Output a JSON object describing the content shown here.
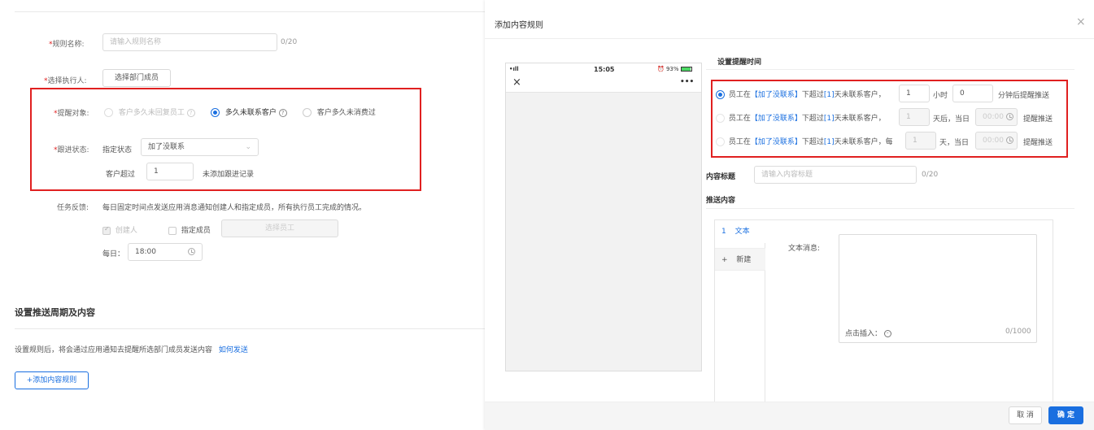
{
  "left": {
    "rule_name": {
      "label": "规则名称:",
      "placeholder": "请输入规则名称",
      "counter": "0/20"
    },
    "executor": {
      "label": "选择执行人:",
      "button": "选择部门成员"
    },
    "remind_target": {
      "label": "提醒对象:",
      "options": [
        {
          "label": "客户多久未回复员工",
          "state": "disabled"
        },
        {
          "label": "多久未联系客户",
          "state": "selected"
        },
        {
          "label": "客户多久未消费过",
          "state": "normal"
        }
      ]
    },
    "follow_status": {
      "label": "跟进状态:",
      "specify_label": "指定状态",
      "select_value": "加了没联系",
      "exceed_label": "客户超过",
      "exceed_value": "1",
      "suffix": "未添加跟进记录"
    },
    "task_feedback": {
      "label": "任务反馈:",
      "text": "每日固定时间点发送应用消息通知创建人和指定成员，所有执行员工完成的情况。",
      "creator_label": "创建人",
      "member_label": "指定成员",
      "select_member_button": "选择员工",
      "daily_label": "每日：",
      "daily_time": "18:00"
    },
    "push_section": {
      "title": "设置推送周期及内容",
      "desc": "设置规则后，将会通过应用通知去提醒所选部门成员发送内容",
      "link": "如何发送",
      "add_button": "+添加内容规则"
    }
  },
  "modal": {
    "title": "添加内容规则",
    "close": "×",
    "phone": {
      "signal": "•ıll",
      "time": "15:05",
      "battery": "93%",
      "close": "×",
      "more": "•••"
    },
    "reminder": {
      "title": "设置提醒时间",
      "rows": [
        {
          "prefix": "员工在",
          "tag": "【加了没联系】",
          "mid": "下超过",
          "n": "[1]",
          "tail": "天未联系客户，",
          "v1": "1",
          "unit1": "小时",
          "v2": "0",
          "unit2": "分钟后提醒推送"
        },
        {
          "prefix": "员工在",
          "tag": "【加了没联系】",
          "mid": "下超过",
          "n": "[1]",
          "tail": "天未联系客户，",
          "v1": "1",
          "unit1": "天后，当日",
          "time": "00:00",
          "unit2": "提醒推送"
        },
        {
          "prefix": "员工在",
          "tag": "【加了没联系】",
          "mid": "下超过",
          "n": "[1]",
          "tail": "天未联系客户，每",
          "v1": "1",
          "unit1": "天，当日",
          "time": "00:00",
          "unit2": "提醒推送"
        }
      ]
    },
    "content_title": {
      "label": "内容标题",
      "placeholder": "请输入内容标题",
      "counter": "0/20"
    },
    "push_content": {
      "label": "推送内容",
      "tabs": [
        {
          "num": "1",
          "label": "文本"
        },
        {
          "num": "+",
          "label": "新建"
        }
      ],
      "text_label": "文本消息:",
      "insert_label": "点击插入：",
      "counter": "0/1000"
    },
    "footer": {
      "cancel": "取 消",
      "confirm": "确 定"
    }
  },
  "colors": {
    "accent": "#1a6fe0",
    "highlight": "#e02020"
  }
}
